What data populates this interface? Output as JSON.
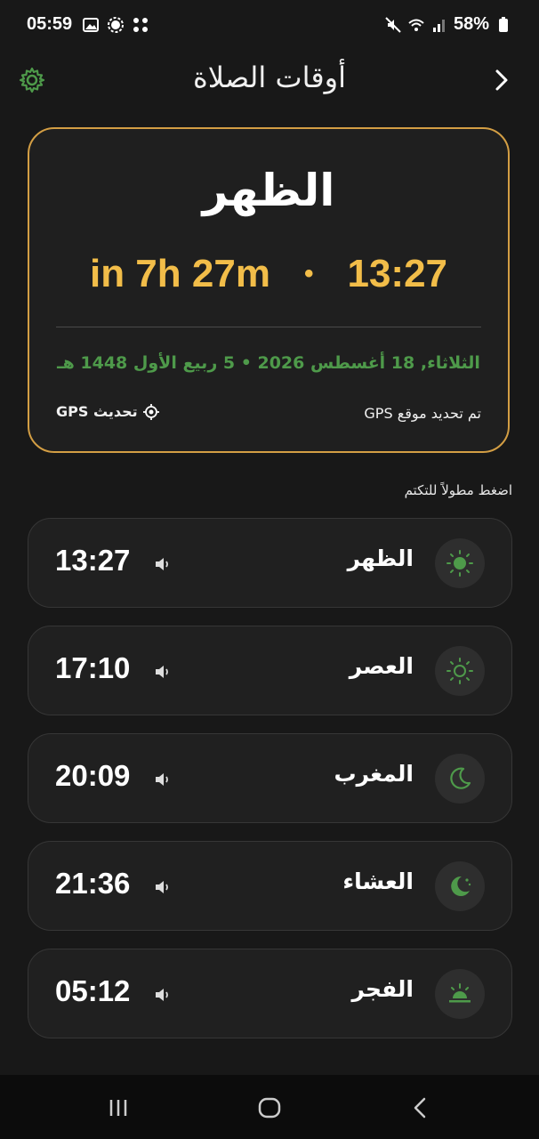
{
  "status_bar": {
    "time": "05:59",
    "battery": "58%"
  },
  "header": {
    "title": "أوقات الصلاة"
  },
  "next_prayer": {
    "name": "الظهر",
    "countdown": "in 7h 27m",
    "separator": "•",
    "time": "13:27",
    "date_line": "الثلاثاء, 18 أغسطس 2026 • 5 ربيع الأول 1448 هـ",
    "gps_status": "تم تحديد موقع GPS",
    "gps_refresh_label": "تحديث GPS"
  },
  "hint": "اضغط مطولاً للتكتم",
  "prayers": [
    {
      "name": "الظهر",
      "time": "13:27",
      "icon": "sun-icon"
    },
    {
      "name": "العصر",
      "time": "17:10",
      "icon": "sun-outline-icon"
    },
    {
      "name": "المغرب",
      "time": "20:09",
      "icon": "moon-outline-icon"
    },
    {
      "name": "العشاء",
      "time": "21:36",
      "icon": "moon-stars-icon"
    },
    {
      "name": "الفجر",
      "time": "05:12",
      "icon": "sunrise-icon"
    }
  ],
  "colors": {
    "accent_gold": "#f2bd49",
    "card_border": "#d39e44",
    "green": "#4e9a4a",
    "background": "#181818"
  }
}
